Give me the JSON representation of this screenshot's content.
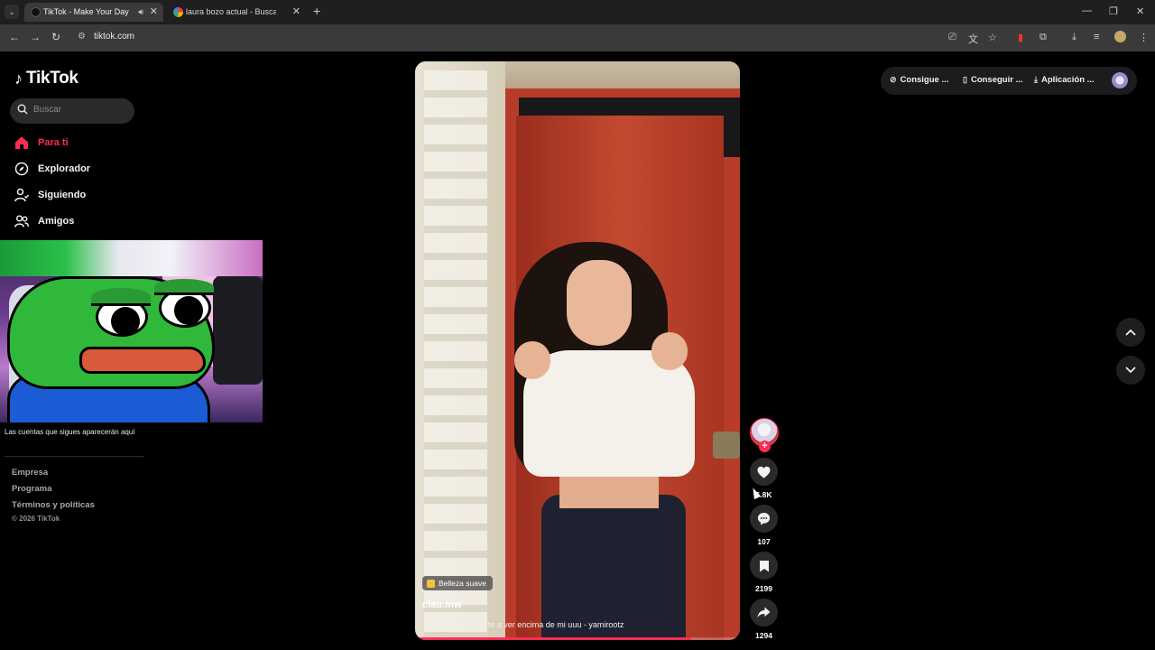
{
  "browser": {
    "tabs": [
      {
        "title": "TikTok - Make Your Day",
        "active": true,
        "audio": true
      },
      {
        "title": "laura bozo actual - Buscar con Google",
        "active": false,
        "audio": false
      }
    ],
    "url": "tiktok.com",
    "new_tab_label": "+",
    "window_controls": {
      "minimize": "—",
      "restore": "❐",
      "close": "✕"
    }
  },
  "sidebar": {
    "brand": "TikTok",
    "search": {
      "placeholder": "Buscar",
      "value": ""
    },
    "nav": [
      {
        "label": "Para ti",
        "icon": "home-icon",
        "active": true
      },
      {
        "label": "Explorador",
        "icon": "compass-icon",
        "active": false
      },
      {
        "label": "Siguiendo",
        "icon": "user-follow-icon",
        "active": false
      },
      {
        "label": "Amigos",
        "icon": "friends-icon",
        "active": false
      }
    ],
    "following_note": "Las cuentas que sigues aparecerán aquí",
    "footer_links": [
      "Empresa",
      "Programa",
      "Términos y políticas"
    ],
    "copyright": "© 2026 TikTok"
  },
  "video": {
    "effect": "Belleza suave",
    "author": "clau.mw",
    "music": "Quisiera volverte a ver encima de mi uuu - yamirootz",
    "progress": 0.85
  },
  "actions": {
    "likes": "6.8K",
    "comments": "107",
    "saves": "2199",
    "shares": "1294"
  },
  "topbar": {
    "coins": "Consigue ...",
    "get_app": "Conseguir ...",
    "app": "Aplicación ..."
  },
  "colors": {
    "accent": "#fe2c55",
    "background": "#000000",
    "chrome": "#3a3a3a"
  }
}
